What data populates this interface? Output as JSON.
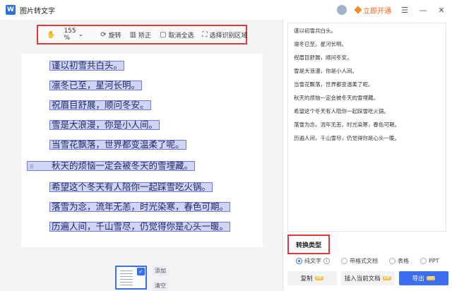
{
  "app": {
    "title": "图片转文字",
    "logo_letter": "W",
    "vip_label": "立即开通"
  },
  "icons": {
    "logo": "word-logo-icon",
    "avatar": "avatar-icon",
    "menu": "menu-icon",
    "minimize": "minimize-icon",
    "close": "close-icon"
  },
  "toolbar": {
    "zoom": "155 %",
    "rotate": "旋转",
    "correct": "矫正",
    "deselect_all": "取消全选",
    "select_region": "选择识别区域"
  },
  "document": {
    "lines": [
      "谨以初雪共白头。",
      "凛冬已至，星河长明。",
      "祝眉目舒展，顺问冬安。",
      "雪是大浪漫，你是小人间。",
      "当雪花飘落，世界都变温柔了呢。",
      "秋天的烦恼一定会被冬天的雪埋藏。",
      "希望这个冬天有人陪你一起踩雪吃火锅。",
      "落雪为念，流年无恙，时光染寒，春色可期。",
      "历遍人间，千山雪尽，仍觉得你是心头一暖。"
    ]
  },
  "thumbs": {
    "add": "添加",
    "clear": "清空"
  },
  "result": {
    "lines": [
      "谨以初雪共白头。",
      "凛冬已至，星河长明。",
      "祝眉目舒展，顺问冬安。",
      "雪是大浪漫，你是小人间。",
      "当雪花飘落，世界都变温柔了呢。",
      "秋天的烦恼一定会被冬天的雪埋藏。",
      "希望这个冬天有人陪你一起踩雪吃火锅。",
      "落雪为念，流年无恙，时光染寒，春色可期。",
      "历遍人间，千山雪尽，仍觉得你是心头一暖。"
    ]
  },
  "conversion": {
    "title": "转换类型",
    "options": [
      "纯文字",
      "带格式文档",
      "表格",
      "PPT"
    ],
    "selected": "纯文字"
  },
  "actions": {
    "copy": "复制",
    "insert": "插入当前文档",
    "export": "导出",
    "vip_tag": "VIP"
  },
  "colors": {
    "accent": "#3b6ef0",
    "highlight_red": "#e23b3b",
    "vip_orange": "#f06a1d"
  }
}
